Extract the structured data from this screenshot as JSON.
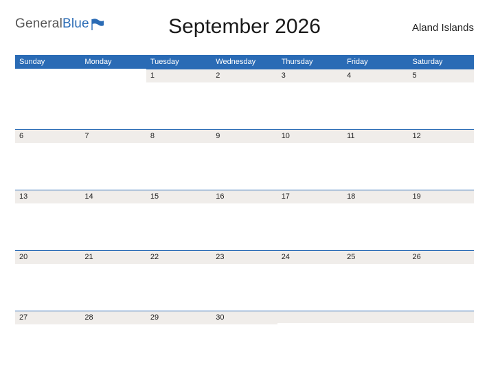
{
  "brand": {
    "name_part1": "General",
    "name_part2": "Blue"
  },
  "title": "September 2026",
  "region": "Aland Islands",
  "day_headers": [
    "Sunday",
    "Monday",
    "Tuesday",
    "Wednesday",
    "Thursday",
    "Friday",
    "Saturday"
  ],
  "weeks": [
    [
      "",
      "",
      "1",
      "2",
      "3",
      "4",
      "5"
    ],
    [
      "6",
      "7",
      "8",
      "9",
      "10",
      "11",
      "12"
    ],
    [
      "13",
      "14",
      "15",
      "16",
      "17",
      "18",
      "19"
    ],
    [
      "20",
      "21",
      "22",
      "23",
      "24",
      "25",
      "26"
    ],
    [
      "27",
      "28",
      "29",
      "30",
      "",
      "",
      ""
    ]
  ],
  "colors": {
    "accent": "#2a6bb5",
    "stripe": "#f0edea"
  }
}
